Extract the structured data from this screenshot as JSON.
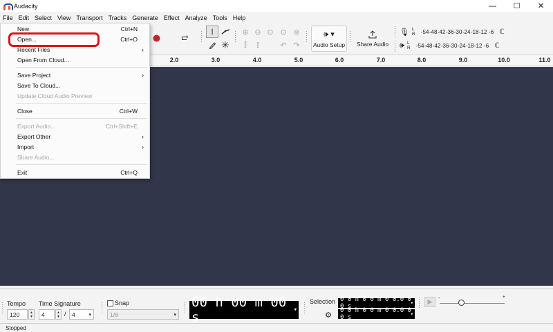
{
  "window": {
    "title": "Audacity",
    "controls": [
      "—",
      "☐",
      "✕"
    ]
  },
  "menubar": [
    "File",
    "Edit",
    "Select",
    "View",
    "Transport",
    "Tracks",
    "Generate",
    "Effect",
    "Analyze",
    "Tools",
    "Help"
  ],
  "toolbar": {
    "audio_setup_label": "Audio Setup",
    "share_audio_label": "Share Audio",
    "meter_lr": [
      "L",
      "R"
    ],
    "meter_ticks": [
      "-54",
      "-48",
      "-42",
      "-36",
      "-30",
      "-24",
      "-18",
      "-12",
      "-6"
    ]
  },
  "ruler": [
    "2.0",
    "3.0",
    "4.0",
    "5.0",
    "6.0",
    "7.0",
    "8.0",
    "9.0",
    "10.0",
    "11.0"
  ],
  "file_menu": [
    {
      "label": "New",
      "shortcut": "Ctrl+N",
      "disabled": false,
      "submenu": false
    },
    {
      "label": "Open...",
      "shortcut": "Ctrl+O",
      "disabled": false,
      "submenu": false
    },
    {
      "label": "Recent Files",
      "shortcut": "",
      "disabled": false,
      "submenu": true
    },
    {
      "label": "Open From Cloud...",
      "shortcut": "",
      "disabled": false,
      "submenu": false
    },
    {
      "label": "Save Project",
      "shortcut": "",
      "disabled": false,
      "submenu": true
    },
    {
      "label": "Save To Cloud...",
      "shortcut": "",
      "disabled": false,
      "submenu": false
    },
    {
      "label": "Update Cloud Audio Preview",
      "shortcut": "",
      "disabled": true,
      "submenu": false
    },
    {
      "label": "Close",
      "shortcut": "Ctrl+W",
      "disabled": false,
      "submenu": false
    },
    {
      "label": "Export Audio...",
      "shortcut": "Ctrl+Shift+E",
      "disabled": true,
      "submenu": false
    },
    {
      "label": "Export Other",
      "shortcut": "",
      "disabled": false,
      "submenu": true
    },
    {
      "label": "Import",
      "shortcut": "",
      "disabled": false,
      "submenu": true
    },
    {
      "label": "Share Audio...",
      "shortcut": "",
      "disabled": true,
      "submenu": false
    },
    {
      "label": "Exit",
      "shortcut": "Ctrl+Q",
      "disabled": false,
      "submenu": false
    }
  ],
  "bottom": {
    "tempo_label": "Tempo",
    "tempo_value": "120",
    "time_sig_label": "Time Signature",
    "time_sig_num": "4",
    "time_sig_slash": "/",
    "time_sig_den": "4",
    "snap_label": "Snap",
    "snap_value": "1/8",
    "time_display": "00 h 00 m 00 s",
    "selection_label": "Selection",
    "selection_start": "0 0 h 0 0 m 0 0.0 0 0 s",
    "selection_end": "0 0 h 0 0 m 0 0.0 0 0 s"
  },
  "status": "Stopped",
  "colors": {
    "track_bg": "#32364a",
    "highlight_ring": "#d9141b",
    "record": "#c0262d"
  }
}
